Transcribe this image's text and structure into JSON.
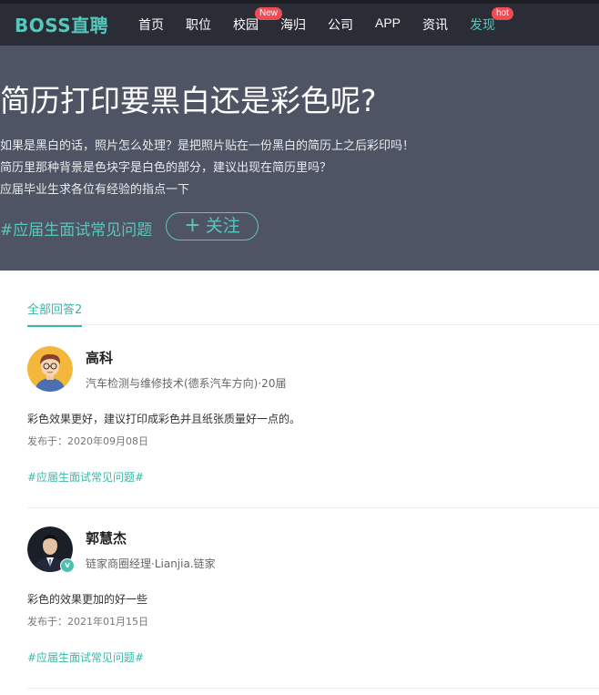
{
  "nav": {
    "logo": "BOSS直聘",
    "items": [
      {
        "label": "首页"
      },
      {
        "label": "职位"
      },
      {
        "label": "校园",
        "badge": "New"
      },
      {
        "label": "海归"
      },
      {
        "label": "公司"
      },
      {
        "label": "APP"
      },
      {
        "label": "资讯"
      },
      {
        "label": "发现",
        "badge": "hot",
        "active": true
      }
    ]
  },
  "question": {
    "title": "简历打印要黑白还是彩色呢?",
    "description": [
      "如果是黑白的话，照片怎么处理？是把照片贴在一份黑白的简历上之后彩印吗！",
      "简历里那种背景是色块字是白色的部分，建议出现在简历里吗？",
      "应届毕业生求各位有经验的指点一下"
    ],
    "tag": "#应届生面试常见问题",
    "follow_label": "关注",
    "follow_icon": "plus-icon"
  },
  "tabs": {
    "all_answers": "全部回答2"
  },
  "answers": [
    {
      "name": "高科",
      "title": "汽车检测与维修技术(德系汽车方向)·20届",
      "content": "彩色效果更好，建议打印成彩色并且纸张质量好一点的。",
      "date": "发布于：2020年09月08日",
      "tag": "#应届生面试常见问题#"
    },
    {
      "name": "郭慧杰",
      "title": "链家商圈经理·Lianjia.链家",
      "content": "彩色的效果更加的好一些",
      "date": "发布于：2021年01月15日",
      "tag": "#应届生面试常见问题#",
      "verified_mark": "v"
    }
  ],
  "colors": {
    "brand": "#58c7bb",
    "nav_bg": "#2a2d36",
    "hero_bg": "#4f5464",
    "badge": "#f14b54"
  }
}
